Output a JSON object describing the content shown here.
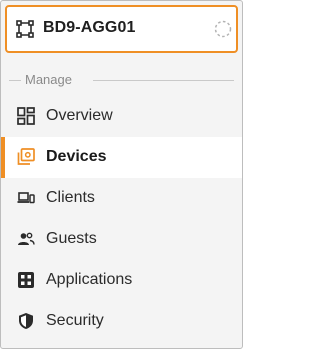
{
  "device": {
    "name": "BD9-AGG01",
    "icon": "topology-icon",
    "status_icon": "status-dashed-circle-icon"
  },
  "section": {
    "label": "Manage"
  },
  "nav": {
    "items": [
      {
        "label": "Overview",
        "icon": "dashboard-grid-icon",
        "active": false
      },
      {
        "label": "Devices",
        "icon": "devices-stack-icon",
        "active": true
      },
      {
        "label": "Clients",
        "icon": "laptop-phone-icon",
        "active": false
      },
      {
        "label": "Guests",
        "icon": "people-icon",
        "active": false
      },
      {
        "label": "Applications",
        "icon": "apps-grid-icon",
        "active": false
      },
      {
        "label": "Security",
        "icon": "shield-icon",
        "active": false
      }
    ]
  },
  "colors": {
    "accent": "#ef8f25",
    "panel_bg": "#f4f4f4",
    "active_bg": "#ffffff",
    "text": "#2b2b2b",
    "muted": "#8a8a8a"
  }
}
